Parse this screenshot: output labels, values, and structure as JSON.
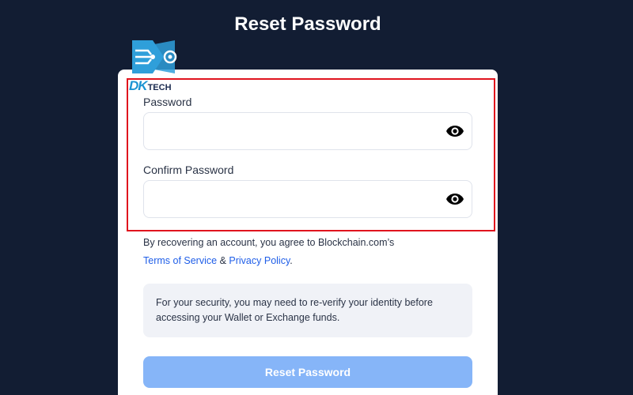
{
  "header": {
    "title": "Reset Password"
  },
  "logo": {
    "brand_prefix": "DK",
    "brand_suffix": "TECH"
  },
  "form": {
    "password_label": "Password",
    "password_value": "",
    "confirm_label": "Confirm Password",
    "confirm_value": "",
    "show_password_icon": "eye-icon"
  },
  "terms": {
    "text": "By recovering an account, you agree to Blockchain.com’s",
    "terms_link": "Terms of Service",
    "separator": "&",
    "privacy_link": "Privacy Policy",
    "end": "."
  },
  "notice": {
    "text": "For your security, you may need to re-verify your identity before accessing your Wallet or Exchange funds."
  },
  "submit": {
    "label": "Reset Password"
  },
  "colors": {
    "background": "#121d33",
    "link": "#1f5ee8",
    "button_disabled": "#86b5f8",
    "highlight": "#e0141e"
  }
}
